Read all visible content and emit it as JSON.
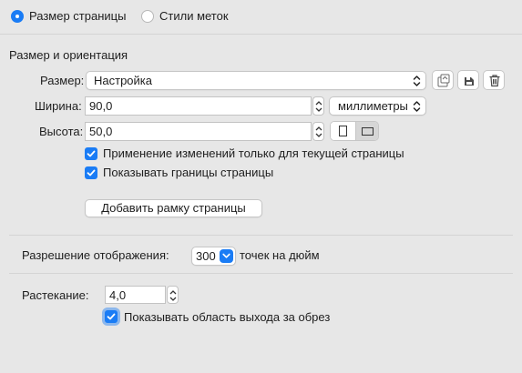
{
  "tabs": [
    {
      "label": "Размер страницы",
      "selected": true
    },
    {
      "label": "Стили меток",
      "selected": false
    }
  ],
  "size_section": {
    "title": "Размер и ориентация",
    "size_label": "Размер:",
    "size_value": "Настройка",
    "width_label": "Ширина:",
    "width_value": "90,0",
    "units_value": "миллиметры",
    "height_label": "Высота:",
    "height_value": "50,0",
    "apply_current_label": "Применение изменений только для текущей страницы",
    "apply_current_checked": true,
    "show_borders_label": "Показывать границы страницы",
    "show_borders_checked": true,
    "add_frame_label": "Добавить рамку страницы"
  },
  "resolution": {
    "label": "Разрешение отображения:",
    "value": "300",
    "unit": "точек на дюйм"
  },
  "bleed": {
    "label": "Растекание:",
    "value": "4,0",
    "show_bleed_label": "Показывать область выхода за обрез",
    "show_bleed_checked": true
  },
  "icons": [
    "save-preset-icon",
    "load-preset-icon",
    "trash-icon",
    "portrait-icon",
    "landscape-icon",
    "chevron-updown-icon"
  ],
  "colors": {
    "accent": "#1a7cf5",
    "background": "#e7e7e7"
  }
}
